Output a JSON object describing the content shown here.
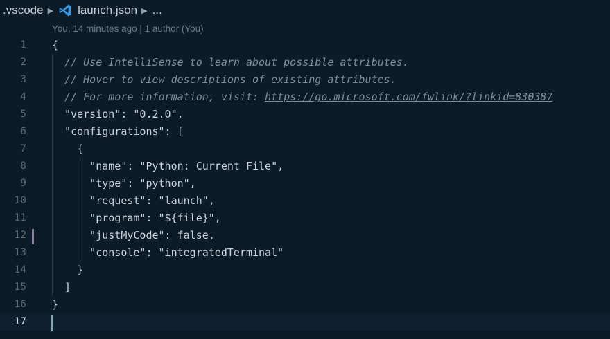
{
  "breadcrumb": {
    "folder": ".vscode",
    "file": "launch.json",
    "more": "..."
  },
  "codelens": "You, 14 minutes ago | 1 author (You)",
  "lines": [
    {
      "n": "1",
      "t": "{"
    },
    {
      "n": "2",
      "t": "  // Use IntelliSense to learn about possible attributes."
    },
    {
      "n": "3",
      "t": "  // Hover to view descriptions of existing attributes."
    },
    {
      "n": "4",
      "t": "  // For more information, visit: ",
      "link": "https://go.microsoft.com/fwlink/?linkid=830387"
    },
    {
      "n": "5",
      "t": "  \"version\": \"0.2.0\","
    },
    {
      "n": "6",
      "t": "  \"configurations\": ["
    },
    {
      "n": "7",
      "t": "    {"
    },
    {
      "n": "8",
      "t": "      \"name\": \"Python: Current File\","
    },
    {
      "n": "9",
      "t": "      \"type\": \"python\","
    },
    {
      "n": "10",
      "t": "      \"request\": \"launch\","
    },
    {
      "n": "11",
      "t": "      \"program\": \"${file}\","
    },
    {
      "n": "12",
      "t": "      \"justMyCode\": false,"
    },
    {
      "n": "13",
      "t": "      \"console\": \"integratedTerminal\""
    },
    {
      "n": "14",
      "t": "    }"
    },
    {
      "n": "15",
      "t": "  ]"
    },
    {
      "n": "16",
      "t": "}"
    },
    {
      "n": "17",
      "t": ""
    }
  ],
  "colors": {
    "background": "#0b1b28",
    "vscode_icon": "#3b9ae1",
    "modified_gutter": "#8d7fa6"
  },
  "icons": {
    "file_icon": "vscode-icon",
    "separator": "chevron-right-icon"
  }
}
